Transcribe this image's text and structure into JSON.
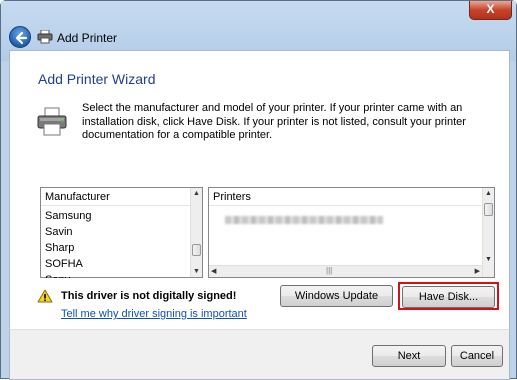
{
  "window": {
    "title": "Add Printer",
    "close_label": "X"
  },
  "wizard": {
    "heading": "Add Printer Wizard",
    "description": "Select the manufacturer and model of your printer. If your printer came with an installation disk, click Have Disk. If your printer is not listed, consult your printer documentation for a compatible printer."
  },
  "manufacturer_list": {
    "header": "Manufacturer",
    "items": [
      "Samsung",
      "Savin",
      "Sharp",
      "SOFHA",
      "Sony"
    ],
    "selected": "SOFHA"
  },
  "printers_list": {
    "header": "Printers"
  },
  "warning": {
    "text": "This driver is not digitally signed!",
    "link": "Tell me why driver signing is important"
  },
  "buttons": {
    "windows_update": "Windows Update",
    "have_disk": "Have Disk...",
    "next": "Next",
    "cancel": "Cancel"
  },
  "colors": {
    "heading": "#1e3f8f",
    "link": "#0f4fbf",
    "highlight": "#d4101a"
  }
}
